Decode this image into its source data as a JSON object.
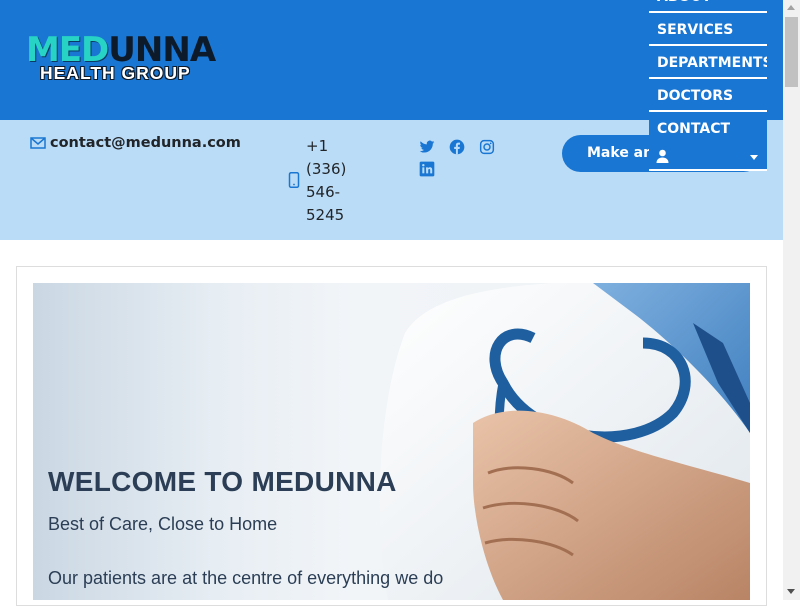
{
  "logo": {
    "text_top_1": "MED",
    "text_top_2": "UNNA",
    "text_bottom": "HEALTH GROUP"
  },
  "contact": {
    "email": "contact@medunna.com",
    "phone": "+1 (336) 546-5245",
    "appointment_button": "Make an Appointment"
  },
  "social": {
    "icons": [
      "twitter-icon",
      "facebook-icon",
      "instagram-icon",
      "linkedin-icon"
    ]
  },
  "nav": {
    "items": [
      {
        "label": "ABOUT"
      },
      {
        "label": "SERVICES"
      },
      {
        "label": "DEPARTMENTS"
      },
      {
        "label": "DOCTORS"
      },
      {
        "label": "CONTACT"
      }
    ],
    "user_icon": "user-icon"
  },
  "hero": {
    "title": "WELCOME TO MEDUNNA",
    "subtitle": "Best of Care, Close to Home",
    "tagline": "Our patients are at the centre of everything we do"
  },
  "colors": {
    "primary": "#1976d2",
    "contact_bar": "#bbdcf7",
    "logo_accent": "#27d3c4",
    "hero_text": "#2b3e55"
  }
}
